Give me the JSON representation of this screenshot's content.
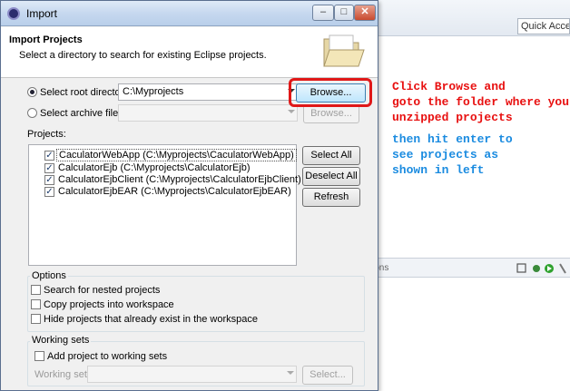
{
  "background": {
    "quick_access": "Quick Access",
    "panel_text": "ions"
  },
  "dialog": {
    "title": "Import",
    "header_title": "Import Projects",
    "header_desc": "Select a directory to search for existing Eclipse projects.",
    "root_dir_label": "Select root directory:",
    "root_dir_value": "C:\\Myprojects",
    "archive_label": "Select archive file:",
    "browse_label": "Browse...",
    "browse2_label": "Browse...",
    "projects_label": "Projects:",
    "projects": [
      "CaculatorWebApp (C:\\Myprojects\\CaculatorWebApp)",
      "CalculatorEjb (C:\\Myprojects\\CalculatorEjb)",
      "CalculatorEjbClient (C:\\Myprojects\\CalculatorEjbClient)",
      "CalculatorEjbEAR (C:\\Myprojects\\CalculatorEjbEAR)"
    ],
    "select_all": "Select All",
    "deselect_all": "Deselect All",
    "refresh": "Refresh",
    "options_title": "Options",
    "opt_nested": "Search for nested projects",
    "opt_copy": "Copy projects into workspace",
    "opt_hide": "Hide projects that already exist in the workspace",
    "working_sets_title": "Working sets",
    "add_to_ws": "Add project to working sets",
    "working_sets_label": "Working sets:",
    "select_btn": "Select..."
  },
  "annotation": {
    "red_lines": [
      "Click Browse and",
      "goto the folder where you",
      "unzipped projects"
    ],
    "blue_lines": [
      "then hit enter to",
      "see projects as",
      "shown in left"
    ]
  },
  "colors": {
    "highlight": "#e01818",
    "note_red": "#e81010",
    "note_blue": "#1a8be0"
  }
}
